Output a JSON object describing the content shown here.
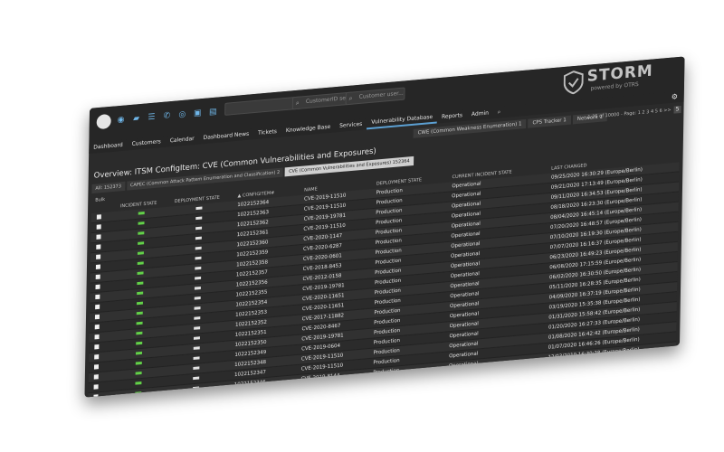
{
  "logo": {
    "name": "STORM",
    "sub": "powered by OTRS"
  },
  "toolbar": {
    "icons": [
      "eye-icon",
      "folder-icon",
      "list-icon",
      "phone-icon",
      "view-icon",
      "lock-icon",
      "unlock-icon"
    ],
    "search_customer_id": "CustomerID se...",
    "search_customer_user": "Customer user..."
  },
  "menu": [
    "Dashboard",
    "Customers",
    "Calendar",
    "Dashboard News",
    "Tickets",
    "Knowledge Base",
    "Services",
    "Vulnerability Database",
    "Reports",
    "Admin"
  ],
  "menu_active_index": 7,
  "top_tabs": [
    "CWE (Common Weakness Enumeration) 1",
    "CPS Tracker 1",
    "Network 1"
  ],
  "top_tabs_active_index": -1,
  "pager": "1-25 of 10000 - Page: 1 2 3 4 5 6 >> ",
  "pager_button": "5",
  "page_title": "Overview: ITSM ConfigItem: CVE (Common Vulnerabilities and Exposures)",
  "sub_tabs": [
    "All: 152373",
    "CAPEC (Common Attack Pattern Enumeration and Classification) 2",
    "CVE (Common Vulnerabilities and Exposures) 152364"
  ],
  "sub_tabs_active_index": 2,
  "bulk_label": "Bulk",
  "columns": {
    "incident_state": "INCIDENT STATE",
    "deployment_state": "DEPLOYMENT STATE",
    "config_item": "▲ CONFIGITEM#",
    "name": "NAME",
    "deployment_state2": "DEPLOYMENT STATE",
    "current_incident_state": "CURRENT INCIDENT STATE",
    "last_changed": "LAST CHANGED"
  },
  "rows": [
    {
      "id": "1022152364",
      "name": "CVE-2019-11510",
      "dep": "Production",
      "state": "Operational",
      "changed": "09/25/2020 16:30:29 (Europe/Berlin)"
    },
    {
      "id": "1022152363",
      "name": "CVE-2019-11510",
      "dep": "Production",
      "state": "Operational",
      "changed": "09/21/2020 17:13:49 (Europe/Berlin)"
    },
    {
      "id": "1022152362",
      "name": "CVE-2019-19781",
      "dep": "Production",
      "state": "Operational",
      "changed": "09/11/2020 16:34:53 (Europe/Berlin)"
    },
    {
      "id": "1022152361",
      "name": "CVE-2019-11510",
      "dep": "Production",
      "state": "Operational",
      "changed": "08/18/2020 16:23:30 (Europe/Berlin)"
    },
    {
      "id": "1022152360",
      "name": "CVE-2020-1147",
      "dep": "Production",
      "state": "Operational",
      "changed": "08/04/2020 16:45:14 (Europe/Berlin)"
    },
    {
      "id": "1022152359",
      "name": "CVE-2020-6287",
      "dep": "Production",
      "state": "Operational",
      "changed": "07/20/2020 16:48:57 (Europe/Berlin)"
    },
    {
      "id": "1022152358",
      "name": "CVE-2020-0601",
      "dep": "Production",
      "state": "Operational",
      "changed": "07/10/2020 16:19:30 (Europe/Berlin)"
    },
    {
      "id": "1022152357",
      "name": "CVE-2018-8453",
      "dep": "Production",
      "state": "Operational",
      "changed": "07/07/2020 16:16:37 (Europe/Berlin)"
    },
    {
      "id": "1022152356",
      "name": "CVE-2012-0158",
      "dep": "Production",
      "state": "Operational",
      "changed": "06/23/2020 16:49:23 (Europe/Berlin)"
    },
    {
      "id": "1022152355",
      "name": "CVE-2019-19781",
      "dep": "Production",
      "state": "Operational",
      "changed": "06/08/2020 17:15:59 (Europe/Berlin)"
    },
    {
      "id": "1022152354",
      "name": "CVE-2020-11651",
      "dep": "Production",
      "state": "Operational",
      "changed": "06/02/2020 16:30:50 (Europe/Berlin)"
    },
    {
      "id": "1022152353",
      "name": "CVE-2020-11651",
      "dep": "Production",
      "state": "Operational",
      "changed": "05/11/2020 16:28:35 (Europe/Berlin)"
    },
    {
      "id": "1022152352",
      "name": "CVE-2017-11882",
      "dep": "Production",
      "state": "Operational",
      "changed": "04/09/2020 16:37:19 (Europe/Berlin)"
    },
    {
      "id": "1022152351",
      "name": "CVE-2020-8467",
      "dep": "Production",
      "state": "Operational",
      "changed": "03/19/2020 15:35:38 (Europe/Berlin)"
    },
    {
      "id": "1022152350",
      "name": "CVE-2019-19781",
      "dep": "Production",
      "state": "Operational",
      "changed": "01/31/2020 15:58:42 (Europe/Berlin)"
    },
    {
      "id": "1022152349",
      "name": "CVE-2019-0604",
      "dep": "Production",
      "state": "Operational",
      "changed": "01/20/2020 16:27:33 (Europe/Berlin)"
    },
    {
      "id": "1022152348",
      "name": "CVE-2019-11510",
      "dep": "Production",
      "state": "Operational",
      "changed": "01/08/2020 16:42:42 (Europe/Berlin)"
    },
    {
      "id": "1022152347",
      "name": "CVE-2019-11510",
      "dep": "Production",
      "state": "Operational",
      "changed": "01/07/2020 16:46:26 (Europe/Berlin)"
    },
    {
      "id": "1022152346",
      "name": "CVE-2019-8144",
      "dep": "Production",
      "state": "Operational",
      "changed": "12/03/2019 16:39:38 (Europe/Berlin)"
    },
    {
      "id": "1022152345",
      "name": "CVE-2019-15759",
      "dep": "Production",
      "state": "Operational",
      "changed": "11/12/2019 16:35:20 (Europe/Berlin)"
    },
    {
      "id": "1022152344",
      "name": "CVE-2019-0708",
      "dep": "Production",
      "state": "Operational",
      "changed": "11/05/2019 16:07:10 (Europe/Berlin)"
    },
    {
      "id": "1022152343",
      "name": "CVE-2019-11539",
      "dep": "Production",
      "state": "Operational",
      "changed": "10/08/2019 16:49:22 (Europe/Berlin)"
    },
    {
      "id": "1022152342",
      "name": "CVE-2019-16928",
      "dep": "Production",
      "state": "Operational",
      "changed": "10/01/2019 17:14:36 (Europe/Berlin)"
    },
    {
      "id": "1022152341",
      "name": "CVE-2019-8578",
      "dep": "Production",
      "state": "Operational",
      "changed": "07/24/2019 17:54:10 (Europe/Berlin)"
    },
    {
      "id": "1022152340",
      "name": "CVE-2018-6789",
      "dep": "Production",
      "state": "Operational",
      "changed": "07/16/2019 16:53:09 (Europe/Berlin)"
    }
  ],
  "colors": {
    "accent": "#5ca0d3",
    "incident_ok": "#62d148",
    "background": "#2b2b2b"
  }
}
